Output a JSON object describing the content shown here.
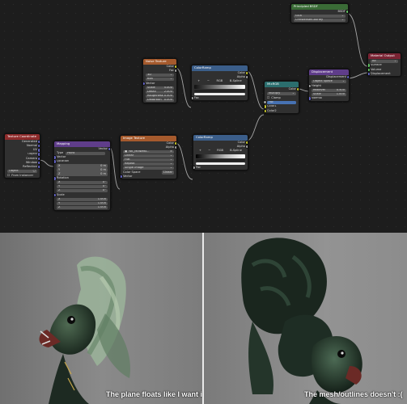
{
  "nodes": {
    "principled_bsdf": {
      "title": "Principled BSDF",
      "output": "BSDF",
      "distribution": "GGX",
      "subsurface_method": "Christensen-Burley"
    },
    "material_output": {
      "title": "Material Output",
      "target": "All",
      "inputs": [
        "Surface",
        "Volume",
        "Displacement"
      ]
    },
    "noise_texture": {
      "title": "Noise Texture",
      "outputs": [
        "Color",
        "Fac"
      ],
      "dimensions": "3D",
      "type": "fBM",
      "inputs": [
        "Vector",
        "Scale",
        "Detail",
        "Roughness",
        "Distortion"
      ],
      "values": {
        "scale": "5.000",
        "detail": "2.000",
        "roughness": "0.500",
        "distortion": "0.000"
      }
    },
    "color_ramp_top": {
      "title": "ColorRamp",
      "outputs": [
        "Color",
        "Alpha"
      ],
      "mode": "RGB",
      "interp": "B-Spline",
      "input": "Fac"
    },
    "mix_rgb": {
      "title": "MixRGB",
      "output": "Color",
      "blend": "Multiply",
      "clamp": "Clamp",
      "inputs": [
        "Fac",
        "Color1",
        "Color2"
      ]
    },
    "displacement": {
      "title": "Displacement",
      "output": "Displacement",
      "space": "Object Space",
      "inputs": [
        "Height",
        "Midlevel",
        "Scale",
        "Normal"
      ],
      "values": {
        "midlevel": "0.500",
        "scale": "1.000"
      }
    },
    "texture_coordinate": {
      "title": "Texture Coordinate",
      "outputs": [
        "Generated",
        "Normal",
        "UV",
        "Object",
        "Camera",
        "Window",
        "Reflection"
      ],
      "object_label": "Object",
      "from_instancer": "From Instancer"
    },
    "mapping": {
      "title": "Mapping",
      "output": "Vector",
      "type_label": "Type",
      "type_value": "Point",
      "inputs": [
        "Vector",
        "Location",
        "Rotation",
        "Scale"
      ],
      "axes": [
        "X",
        "Y",
        "Z"
      ],
      "location": [
        "0 m",
        "0 m",
        "0 m"
      ],
      "rotation": [
        "0°",
        "0°",
        "0°"
      ],
      "scale": [
        "1.000",
        "1.000",
        "1.000"
      ]
    },
    "image_texture": {
      "title": "Image Texture",
      "outputs": [
        "Color",
        "Alpha"
      ],
      "image_name": "NK_Midwest...",
      "interpolation": "Linear",
      "projection": "Flat",
      "extension": "Repeat",
      "source": "Single Image",
      "color_space_label": "Color Space",
      "color_space": "Linear",
      "input": "Vector"
    },
    "color_ramp_bottom": {
      "title": "ColorRamp",
      "outputs": [
        "Color",
        "Alpha"
      ],
      "mode": "RGB",
      "interp": "B-Spline",
      "input": "Fac"
    }
  },
  "captions": {
    "left": "The plane floats like I want it to",
    "right": "The mesh/outlines doesn't :("
  },
  "colors": {
    "editor_bg": "#1d1d1d",
    "node_bg": "#303030",
    "texture_header": "#a55a2d",
    "vector_header": "#5f3d8a",
    "input_header": "#8d2b2b",
    "converter_header": "#3b5e8a",
    "shader_header": "#3a6b36",
    "output_header": "#7a2333",
    "socket_color": "#c7c729",
    "socket_float": "#a1a1a1",
    "socket_vector": "#6363c7",
    "socket_shader": "#63c763"
  }
}
